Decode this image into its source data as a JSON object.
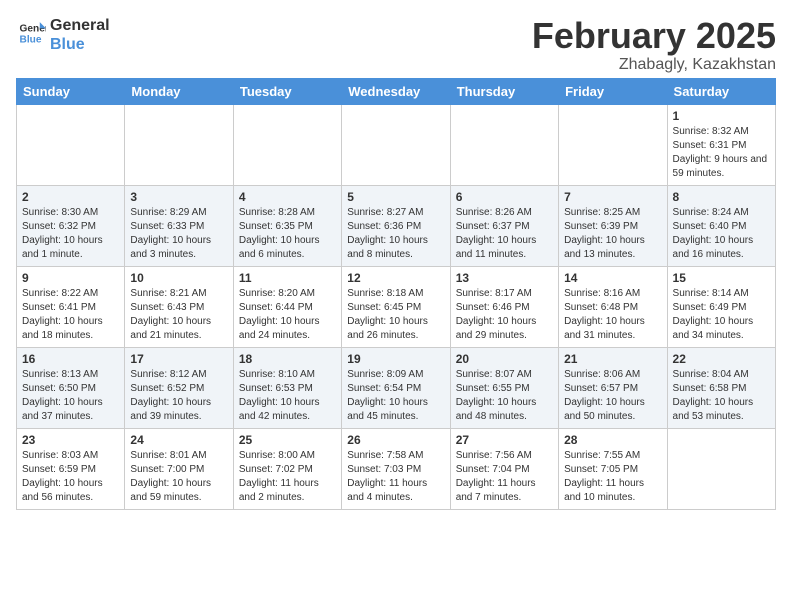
{
  "header": {
    "logo_text_general": "General",
    "logo_text_blue": "Blue",
    "month_title": "February 2025",
    "location": "Zhabagly, Kazakhstan"
  },
  "days_of_week": [
    "Sunday",
    "Monday",
    "Tuesday",
    "Wednesday",
    "Thursday",
    "Friday",
    "Saturday"
  ],
  "weeks": [
    [
      {
        "num": "",
        "info": ""
      },
      {
        "num": "",
        "info": ""
      },
      {
        "num": "",
        "info": ""
      },
      {
        "num": "",
        "info": ""
      },
      {
        "num": "",
        "info": ""
      },
      {
        "num": "",
        "info": ""
      },
      {
        "num": "1",
        "info": "Sunrise: 8:32 AM\nSunset: 6:31 PM\nDaylight: 9 hours and 59 minutes."
      }
    ],
    [
      {
        "num": "2",
        "info": "Sunrise: 8:30 AM\nSunset: 6:32 PM\nDaylight: 10 hours and 1 minute."
      },
      {
        "num": "3",
        "info": "Sunrise: 8:29 AM\nSunset: 6:33 PM\nDaylight: 10 hours and 3 minutes."
      },
      {
        "num": "4",
        "info": "Sunrise: 8:28 AM\nSunset: 6:35 PM\nDaylight: 10 hours and 6 minutes."
      },
      {
        "num": "5",
        "info": "Sunrise: 8:27 AM\nSunset: 6:36 PM\nDaylight: 10 hours and 8 minutes."
      },
      {
        "num": "6",
        "info": "Sunrise: 8:26 AM\nSunset: 6:37 PM\nDaylight: 10 hours and 11 minutes."
      },
      {
        "num": "7",
        "info": "Sunrise: 8:25 AM\nSunset: 6:39 PM\nDaylight: 10 hours and 13 minutes."
      },
      {
        "num": "8",
        "info": "Sunrise: 8:24 AM\nSunset: 6:40 PM\nDaylight: 10 hours and 16 minutes."
      }
    ],
    [
      {
        "num": "9",
        "info": "Sunrise: 8:22 AM\nSunset: 6:41 PM\nDaylight: 10 hours and 18 minutes."
      },
      {
        "num": "10",
        "info": "Sunrise: 8:21 AM\nSunset: 6:43 PM\nDaylight: 10 hours and 21 minutes."
      },
      {
        "num": "11",
        "info": "Sunrise: 8:20 AM\nSunset: 6:44 PM\nDaylight: 10 hours and 24 minutes."
      },
      {
        "num": "12",
        "info": "Sunrise: 8:18 AM\nSunset: 6:45 PM\nDaylight: 10 hours and 26 minutes."
      },
      {
        "num": "13",
        "info": "Sunrise: 8:17 AM\nSunset: 6:46 PM\nDaylight: 10 hours and 29 minutes."
      },
      {
        "num": "14",
        "info": "Sunrise: 8:16 AM\nSunset: 6:48 PM\nDaylight: 10 hours and 31 minutes."
      },
      {
        "num": "15",
        "info": "Sunrise: 8:14 AM\nSunset: 6:49 PM\nDaylight: 10 hours and 34 minutes."
      }
    ],
    [
      {
        "num": "16",
        "info": "Sunrise: 8:13 AM\nSunset: 6:50 PM\nDaylight: 10 hours and 37 minutes."
      },
      {
        "num": "17",
        "info": "Sunrise: 8:12 AM\nSunset: 6:52 PM\nDaylight: 10 hours and 39 minutes."
      },
      {
        "num": "18",
        "info": "Sunrise: 8:10 AM\nSunset: 6:53 PM\nDaylight: 10 hours and 42 minutes."
      },
      {
        "num": "19",
        "info": "Sunrise: 8:09 AM\nSunset: 6:54 PM\nDaylight: 10 hours and 45 minutes."
      },
      {
        "num": "20",
        "info": "Sunrise: 8:07 AM\nSunset: 6:55 PM\nDaylight: 10 hours and 48 minutes."
      },
      {
        "num": "21",
        "info": "Sunrise: 8:06 AM\nSunset: 6:57 PM\nDaylight: 10 hours and 50 minutes."
      },
      {
        "num": "22",
        "info": "Sunrise: 8:04 AM\nSunset: 6:58 PM\nDaylight: 10 hours and 53 minutes."
      }
    ],
    [
      {
        "num": "23",
        "info": "Sunrise: 8:03 AM\nSunset: 6:59 PM\nDaylight: 10 hours and 56 minutes."
      },
      {
        "num": "24",
        "info": "Sunrise: 8:01 AM\nSunset: 7:00 PM\nDaylight: 10 hours and 59 minutes."
      },
      {
        "num": "25",
        "info": "Sunrise: 8:00 AM\nSunset: 7:02 PM\nDaylight: 11 hours and 2 minutes."
      },
      {
        "num": "26",
        "info": "Sunrise: 7:58 AM\nSunset: 7:03 PM\nDaylight: 11 hours and 4 minutes."
      },
      {
        "num": "27",
        "info": "Sunrise: 7:56 AM\nSunset: 7:04 PM\nDaylight: 11 hours and 7 minutes."
      },
      {
        "num": "28",
        "info": "Sunrise: 7:55 AM\nSunset: 7:05 PM\nDaylight: 11 hours and 10 minutes."
      },
      {
        "num": "",
        "info": ""
      }
    ]
  ]
}
